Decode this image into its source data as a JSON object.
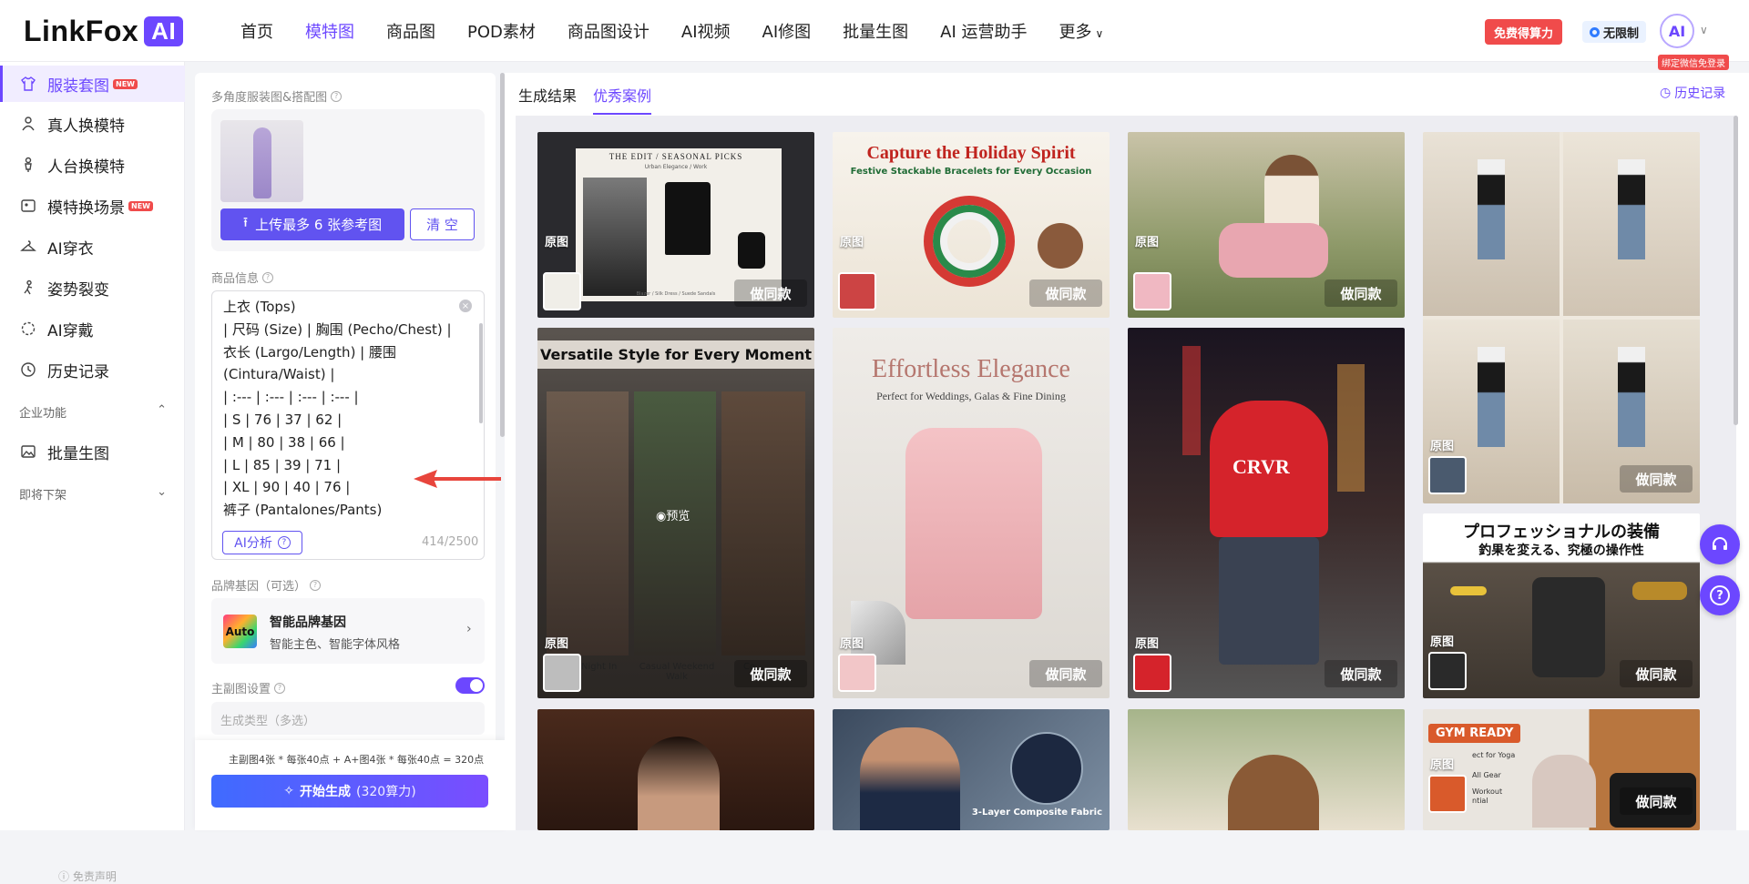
{
  "app": {
    "logo_text": "LinkFox",
    "logo_badge": "AI"
  },
  "nav": {
    "items": [
      "首页",
      "模特图",
      "商品图",
      "POD素材",
      "商品图设计",
      "AI视频",
      "AI修图",
      "批量生图",
      "AI 运营助手"
    ],
    "more": "更多",
    "active_index": 1
  },
  "header": {
    "promo": "免费得算力",
    "unlimited": "无限制",
    "avatar_text": "AI",
    "bind_tip": "绑定微信免登录"
  },
  "sidebar": {
    "items": [
      {
        "label": "服装套图",
        "icon": "shirt-icon",
        "badge": "NEW"
      },
      {
        "label": "真人换模特",
        "icon": "person-swap-icon"
      },
      {
        "label": "人台换模特",
        "icon": "mannequin-icon"
      },
      {
        "label": "模特换场景",
        "icon": "scene-icon",
        "badge": "NEW"
      },
      {
        "label": "AI穿衣",
        "icon": "hanger-icon"
      },
      {
        "label": "姿势裂变",
        "icon": "pose-icon"
      },
      {
        "label": "AI穿戴",
        "icon": "wear-icon"
      },
      {
        "label": "历史记录",
        "icon": "clock-icon"
      }
    ],
    "group_enterprise": "企业功能",
    "batch": "批量生图",
    "group_soon": "即将下架",
    "disclaimer": "免责声明"
  },
  "panel": {
    "multi_angle_label": "多角度服装图&搭配图",
    "upload_button": "上传最多 6 张参考图",
    "clear_button": "清 空",
    "product_info_label": "商品信息",
    "product_info_text": "上衣 (Tops)\n| 尺码 (Size) | 胸围 (Pecho/Chest) | 衣长 (Largo/Length) | 腰围 (Cintura/Waist) |\n| :--- | :--- | :--- | :--- |\n| S | 76 | 37 | 62 |\n| M | 80 | 38 | 66 |\n| L | 85 | 39 | 71 |\n| XL | 90 | 40 | 76 |\n裤子 (Pantalones/Pants)",
    "ai_analyze": "AI分析",
    "char_count": "414/2500",
    "brand_label": "品牌基因（可选）",
    "brand_logo_text": "Auto",
    "brand_title": "智能品牌基因",
    "brand_sub": "智能主色、智能字体风格",
    "main_image_label": "主副图设置",
    "main_image_toggle": true,
    "gen_type_placeholder": "生成类型（多选）",
    "cost_text": "主副图4张 * 每张40点 + A+图4张 * 每张40点 = 320点",
    "start_button": "开始生成",
    "start_button_sub": "(320算力)"
  },
  "content": {
    "tabs": [
      "生成结果",
      "优秀案例"
    ],
    "active_tab": 1,
    "history": "历史记录",
    "original_label": "原图",
    "same_style_label": "做同款",
    "preview_label": "预览",
    "cards": {
      "c1_title": "THE EDIT / SEASONAL PICKS",
      "c1_sub": "Urban Elegance / Work",
      "c1_foot": "Blazer / Silk Dress / Suede Sandals",
      "c2_title": "Capture the Holiday Spirit",
      "c2_sub": "Festive Stackable Bracelets for Every Occasion",
      "c5_title": "Versatile Style for Every Moment",
      "c5_cap1": "Night In",
      "c5_cap2": "Casual Weekend Walk",
      "c5_cap3": "Co...",
      "c6_title": "Effortless Elegance",
      "c6_sub": "Perfect for Weddings, Galas & Fine Dining",
      "c7_logo": "CRVR",
      "c8_title": "プロフェッショナルの装備",
      "c8_sub": "釣果を変える、究極の操作性",
      "c10_caption": "3-Layer Composite Fabric",
      "c12_title": "GYM READY",
      "c12_line1": "ect for Yoga",
      "c12_line2": "All Gear",
      "c12_line3": "Workout",
      "c12_line4": "ntial"
    }
  },
  "colors": {
    "accent": "#6c47ff",
    "promo": "#f04b4b",
    "upload": "#6153f0"
  }
}
